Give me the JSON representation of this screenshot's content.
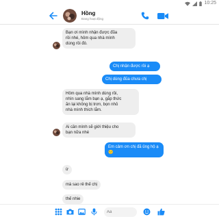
{
  "status_bar": {
    "time": "10:25"
  },
  "header": {
    "contact_name": "Hồng",
    "contact_status": "Đang hoạt động"
  },
  "messages": [
    {
      "direction": "incoming",
      "text": "Bạn ơi mình nhận được đũa\nrồi nhé, hôm qua nhà mình\ndùng rồi đó."
    },
    {
      "direction": "outgoing",
      "text": "Chị nhận được rồi ạ"
    },
    {
      "direction": "outgoing",
      "text": "Chị dùng đũa chưa chị"
    },
    {
      "direction": "incoming",
      "text": "Hôm qua nhà mình dùng rồi,\nnhìn sang lắm bạn ạ, gắp thức\năn lại không bị trơn, bọn nhỏ\nnhà mình thích lắm."
    },
    {
      "direction": "incoming",
      "text": "Ai cần mình sẽ giới thiệu cho\nbạn nữa nhé"
    },
    {
      "direction": "outgoing",
      "text": "Em cảm ơn chị đã ủng hộ ạ\n🙂"
    },
    {
      "direction": "incoming",
      "text": "ừ"
    },
    {
      "direction": "incoming",
      "text": "mà sao rẻ thế chị"
    },
    {
      "direction": "incoming",
      "text": "thế nhie"
    }
  ],
  "composer": {
    "placeholder": "Aa"
  },
  "colors": {
    "accent": "#1a8bf7",
    "incoming_bubble": "#eeeeee",
    "outgoing_text": "#ffffff"
  },
  "icons": {
    "header": [
      "back-arrow-icon",
      "call-icon",
      "video-call-icon"
    ],
    "composer": [
      "grid-icon",
      "camera-icon",
      "image-icon",
      "microphone-icon",
      "emoji-icon",
      "like-icon"
    ]
  }
}
